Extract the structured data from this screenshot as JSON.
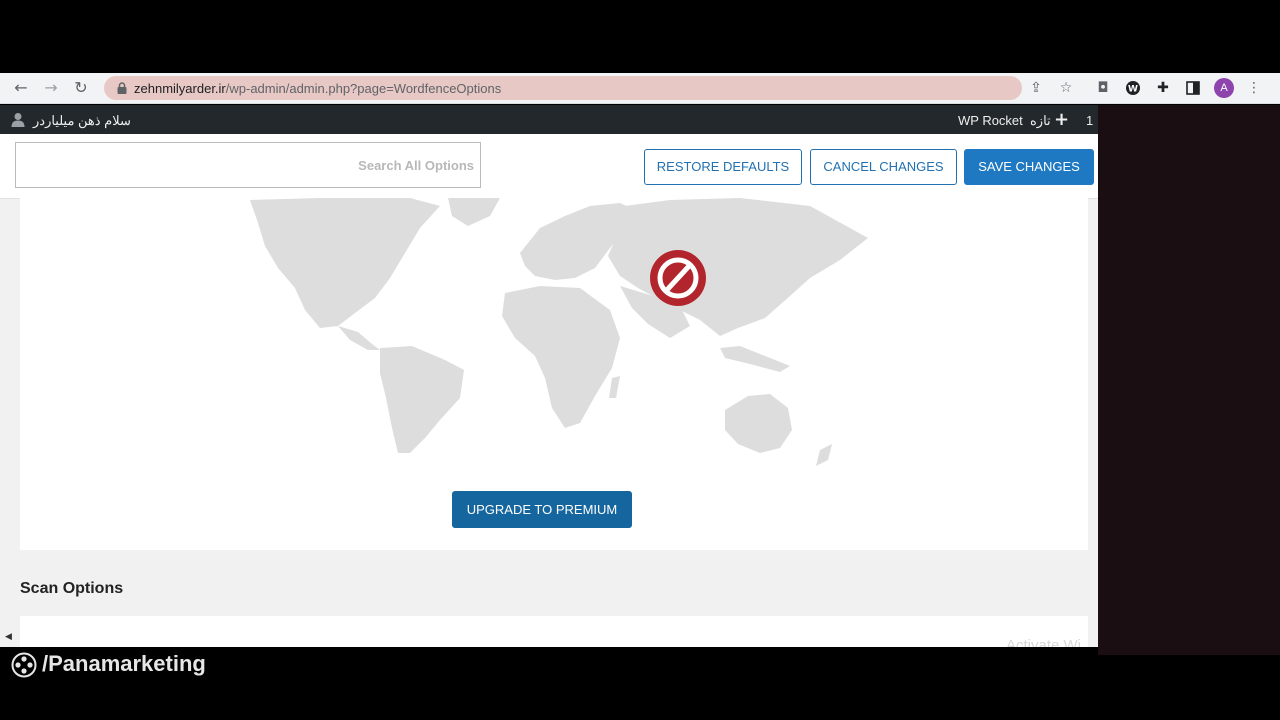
{
  "browser": {
    "url_domain": "zehnmilyarder.ir",
    "url_path": "/wp-admin/admin.php?page=WordfenceOptions",
    "profile_initial": "A",
    "icons": [
      "back-icon",
      "forward-icon",
      "reload-icon",
      "lock-icon",
      "share-icon",
      "star-icon",
      "camera-icon",
      "wordpress-icon",
      "extensions-icon",
      "sidepanel-icon",
      "menu-icon"
    ]
  },
  "admin_bar": {
    "greeting": "سلام ذهن میلیاردر",
    "count": "1",
    "new_label": "تازه",
    "plugin_label": "WP Rocket"
  },
  "options_bar": {
    "search_placeholder": "Search All Options",
    "restore_label": "RESTORE DEFAULTS",
    "cancel_label": "CANCEL CHANGES",
    "save_label": "SAVE CHANGES"
  },
  "content": {
    "upgrade_label": "UPGRADE TO PREMIUM",
    "section_title": "Scan Options",
    "watermark": "Activate Wi"
  },
  "overlay": {
    "brand": "/Panamarketing"
  },
  "colors": {
    "primary": "#1e78c2",
    "upgrade": "#15659f",
    "block_red": "#b3252c",
    "admin_bar": "#23282d",
    "map_land": "#dddddd"
  }
}
